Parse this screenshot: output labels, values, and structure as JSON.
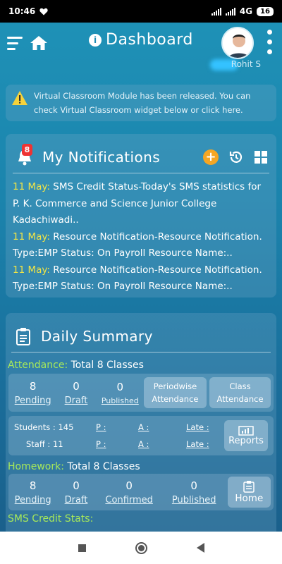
{
  "status_bar": {
    "time": "10:46",
    "network": "4G",
    "battery": "16"
  },
  "header": {
    "title": "Dashboard",
    "username": "Rohit S"
  },
  "alert": {
    "text": "Virtual Classroom Module has been released. You can check Virtual Classroom widget below or click here."
  },
  "notifications": {
    "title": "My Notifications",
    "badge": "8",
    "items": [
      {
        "date": "11 May:",
        "text": " SMS Credit Status-Today's SMS statistics for P. K. Commerce and Science Junior College Kadachiwadi.."
      },
      {
        "date": "11 May:",
        "text": " Resource Notification-Resource Notification. Type:EMP Status: On Payroll Resource Name:.."
      },
      {
        "date": "11 May:",
        "text": " Resource Notification-Resource Notification. Type:EMP Status: On Payroll Resource Name:.."
      }
    ]
  },
  "summary": {
    "title": "Daily Summary",
    "attendance": {
      "label": "Attendance:",
      "total": "Total 8 Classes",
      "stats": [
        {
          "value": "8",
          "label": "Pending"
        },
        {
          "value": "0",
          "label": "Draft"
        },
        {
          "value": "0",
          "label": "Published"
        }
      ],
      "btn_periodwise_1": "Periodwise",
      "btn_periodwise_2": "Attendance",
      "btn_class_1": "Class",
      "btn_class_2": "Attendance",
      "students_label": "Students :",
      "students_value": "145",
      "staff_label": "Staff :",
      "staff_value": "11",
      "p_label": "P :",
      "a_label": "A :",
      "late_label": "Late :",
      "reports": "Reports"
    },
    "homework": {
      "label": "Homework:",
      "total": "Total 8 Classes",
      "stats": [
        {
          "value": "8",
          "label": "Pending"
        },
        {
          "value": "0",
          "label": "Draft"
        },
        {
          "value": "0",
          "label": "Confirmed"
        },
        {
          "value": "0",
          "label": "Published"
        }
      ],
      "home_btn": "Home"
    },
    "sms_label": "SMS Credit Stats:"
  },
  "colors": {
    "accent_green": "#a6e85a",
    "date_yellow": "#f2e545",
    "badge_red": "#e33333",
    "add_orange": "#f5a623"
  }
}
